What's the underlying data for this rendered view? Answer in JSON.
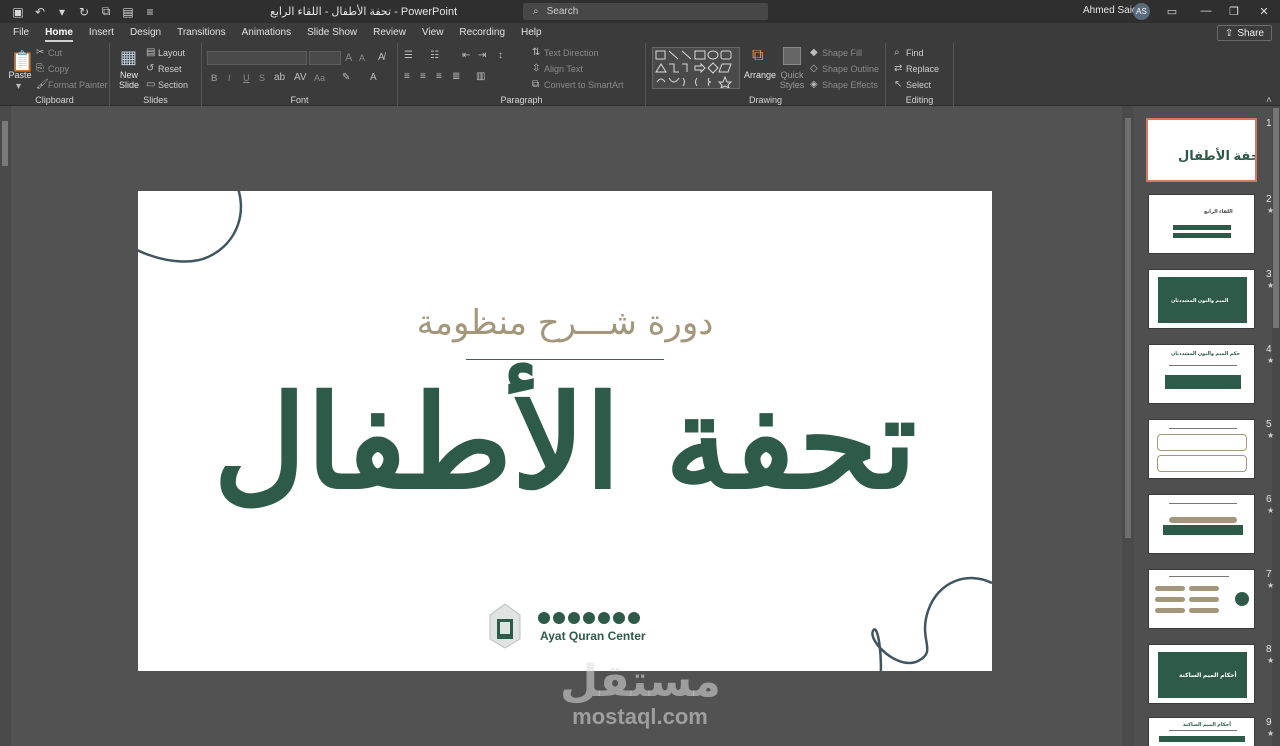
{
  "titlebar": {
    "title": "تحفة الأطفال - اللقاء الرابع  -  PowerPoint",
    "search_placeholder": "Search",
    "user_name": "Ahmed Said",
    "user_initials": "AS"
  },
  "tabs": [
    "File",
    "Home",
    "Insert",
    "Design",
    "Transitions",
    "Animations",
    "Slide Show",
    "Review",
    "View",
    "Recording",
    "Help"
  ],
  "active_tab": "Home",
  "share_label": "Share",
  "ribbon": {
    "clipboard": {
      "paste": "Paste",
      "cut": "Cut",
      "copy": "Copy",
      "format_painter": "Format Painter",
      "label": "Clipboard"
    },
    "slides": {
      "new_slide": "New Slide",
      "layout": "Layout",
      "reset": "Reset",
      "section": "Section",
      "label": "Slides"
    },
    "font": {
      "label": "Font",
      "bold": "B",
      "italic": "I",
      "underline": "U",
      "strike": "S",
      "size_up": "A",
      "size_down": "A",
      "change_case": "Aa"
    },
    "paragraph": {
      "label": "Paragraph",
      "text_direction": "Text Direction",
      "align_text": "Align Text",
      "convert_smartart": "Convert to SmartArt"
    },
    "drawing": {
      "label": "Drawing",
      "arrange": "Arrange",
      "quick_styles": "Quick Styles",
      "shape_fill": "Shape Fill",
      "shape_outline": "Shape Outline",
      "shape_effects": "Shape Effects"
    },
    "editing": {
      "label": "Editing",
      "find": "Find",
      "replace": "Replace",
      "select": "Select"
    }
  },
  "slide": {
    "subtitle": "دورة شـــرح منظومة",
    "title": "تحفة الأطفال",
    "brand": "Ayat Quran Center"
  },
  "watermark": {
    "arabic": "مستقل",
    "latin": "mostaql.com"
  },
  "thumbnails": [
    {
      "num": "1",
      "star": "",
      "title": "تحفة الأطفال"
    },
    {
      "num": "2",
      "star": "★",
      "title": "اللقاء الرابع"
    },
    {
      "num": "3",
      "star": "★",
      "title": "الميم والنون المشددتان"
    },
    {
      "num": "4",
      "star": "★",
      "title": "حكم الميم والنون المشددتان"
    },
    {
      "num": "5",
      "star": "★",
      "title": ""
    },
    {
      "num": "6",
      "star": "★",
      "title": ""
    },
    {
      "num": "7",
      "star": "★",
      "title": ""
    },
    {
      "num": "8",
      "star": "★",
      "title": "أحكام الميم الساكنة"
    },
    {
      "num": "9",
      "star": "★",
      "title": "أحكام الميم الساكنة"
    }
  ],
  "colors": {
    "accent_green": "#2e5a4a",
    "accent_gold": "#a4967a",
    "selection": "#d7775b"
  }
}
